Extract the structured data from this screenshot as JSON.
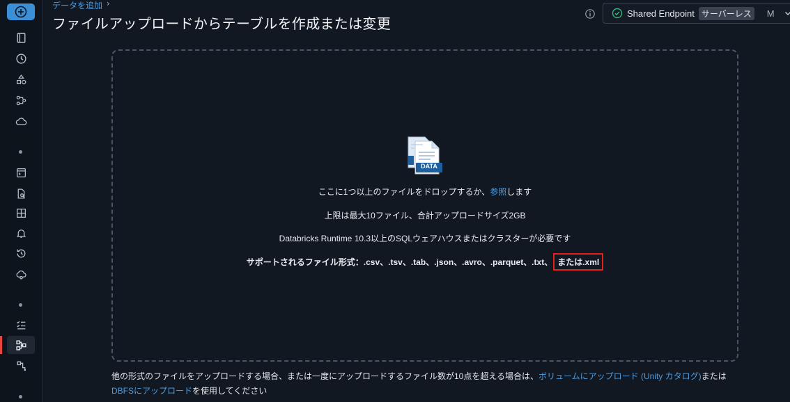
{
  "breadcrumb": {
    "label": "データを追加",
    "separator": "›"
  },
  "page": {
    "title": "ファイルアップロードからテーブルを作成または変更"
  },
  "endpoint": {
    "name": "Shared Endpoint",
    "badge": "サーバーレス",
    "size": "M",
    "status_color": "#2fb67c"
  },
  "sidebar": {
    "icons": [
      "new-icon",
      "notebook-icon",
      "clock-icon",
      "shapes-icon",
      "workflow-icon",
      "cloud-icon",
      "sql-editor-icon",
      "query-icon",
      "dashboard-icon",
      "alert-icon",
      "history-icon",
      "cloud-data-icon",
      "checklist-icon",
      "pipeline-icon",
      "model-icon"
    ],
    "active": "pipeline-icon"
  },
  "dropzone": {
    "badge": "DATA",
    "line1_prefix": "ここに1つ以上のファイルをドロップするか、",
    "line1_link": "参照",
    "line1_suffix": "します",
    "line2": "上限は最大10ファイル、合計アップロードサイズ2GB",
    "line3": "Databricks Runtime 10.3以上のSQLウェアハウスまたはクラスターが必要です",
    "line4_prefix": "サポートされるファイル形式：.csv、.tsv、.tab、.json、.avro、.parquet、.txt、",
    "line4_highlight": "または.xml"
  },
  "footer": {
    "text1": "他の形式のファイルをアップロードする場合、または一度にアップロードするファイル数が10点を超える場合は、",
    "link1": "ボリュームにアップロード (Unity カタログ)",
    "text2": "または",
    "link2": "DBFSにアップロード",
    "text3": "を使用してください"
  },
  "colors": {
    "accent": "#4d9de0",
    "highlight_border": "#e2231a",
    "background": "#121821"
  }
}
